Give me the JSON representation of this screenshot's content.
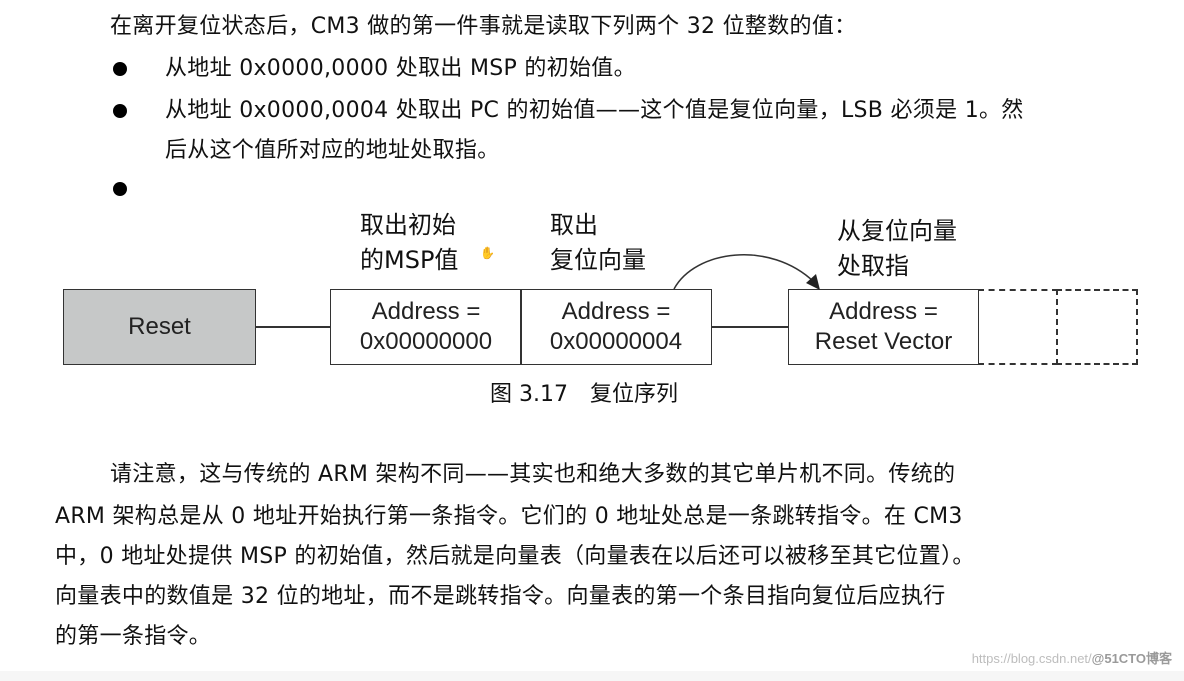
{
  "intro": {
    "text": "在离开复位状态后，CM3 做的第一件事就是读取下列两个 32 位整数的值："
  },
  "bullets": [
    {
      "line1": "从地址 0x0000,0000 处取出 MSP 的初始值。"
    },
    {
      "line1": "从地址 0x0000,0004 处取出 PC 的初始值——这个值是复位向量，LSB 必须是 1。然",
      "line2": "后从这个值所对应的地址处取指。"
    },
    {
      "line1": ""
    }
  ],
  "diagram": {
    "labels": {
      "fetch_msp_line1": "取出初始",
      "fetch_msp_line2": "的MSP值",
      "fetch_vector_line1": "取出",
      "fetch_vector_line2": "复位向量",
      "fetch_instr_line1": "从复位向量",
      "fetch_instr_line2": "处取指"
    },
    "boxes": {
      "reset": "Reset",
      "addr0_line1": "Address =",
      "addr0_line2": "0x00000000",
      "addr4_line1": "Address =",
      "addr4_line2": "0x00000004",
      "vector_line1": "Address =",
      "vector_line2": "Reset Vector"
    },
    "cursor_icon": "hand-cursor-icon",
    "caption": "图 3.17　复位序列"
  },
  "paragraph": {
    "lines": [
      "请注意，这与传统的 ARM 架构不同——其实也和绝大多数的其它单片机不同。传统的",
      "ARM 架构总是从 0 地址开始执行第一条指令。它们的 0 地址处总是一条跳转指令。在 CM3",
      "中，0 地址处提供 MSP 的初始值，然后就是向量表（向量表在以后还可以被移至其它位置）。",
      "向量表中的数值是 32 位的地址，而不是跳转指令。向量表的第一个条目指向复位后应执行",
      "的第一条指令。"
    ]
  },
  "watermark": {
    "url": "https://blog.csdn.net/",
    "brand": "@51CTO博客"
  }
}
